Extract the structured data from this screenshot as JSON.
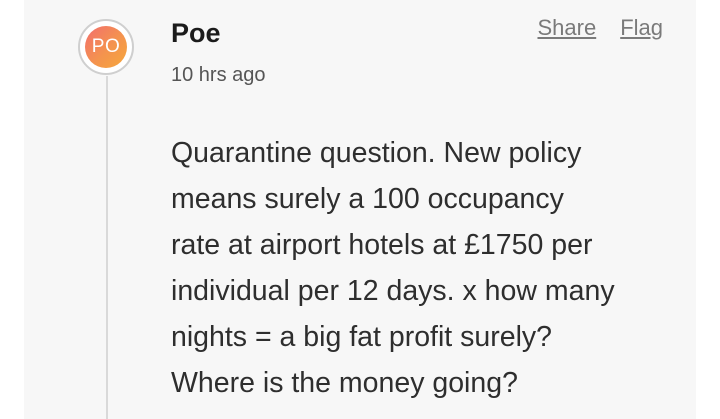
{
  "comment": {
    "avatar_initials": "PO",
    "author": "Poe",
    "timestamp": "10 hrs ago",
    "actions": {
      "share_label": "Share",
      "flag_label": "Flag"
    },
    "body_lines": [
      "Quarantine question. New policy",
      "means surely a 100 occupancy",
      "rate at airport hotels at £1750 per",
      "individual per 12 days. x how many",
      "nights = a big fat profit surely?",
      "Where is the money going?"
    ]
  },
  "colors": {
    "card_background": "#f7f7f7",
    "avatar_gradient_start": "#f26e6e",
    "avatar_gradient_end": "#f6a83c",
    "link_color": "#7a7a7a"
  }
}
